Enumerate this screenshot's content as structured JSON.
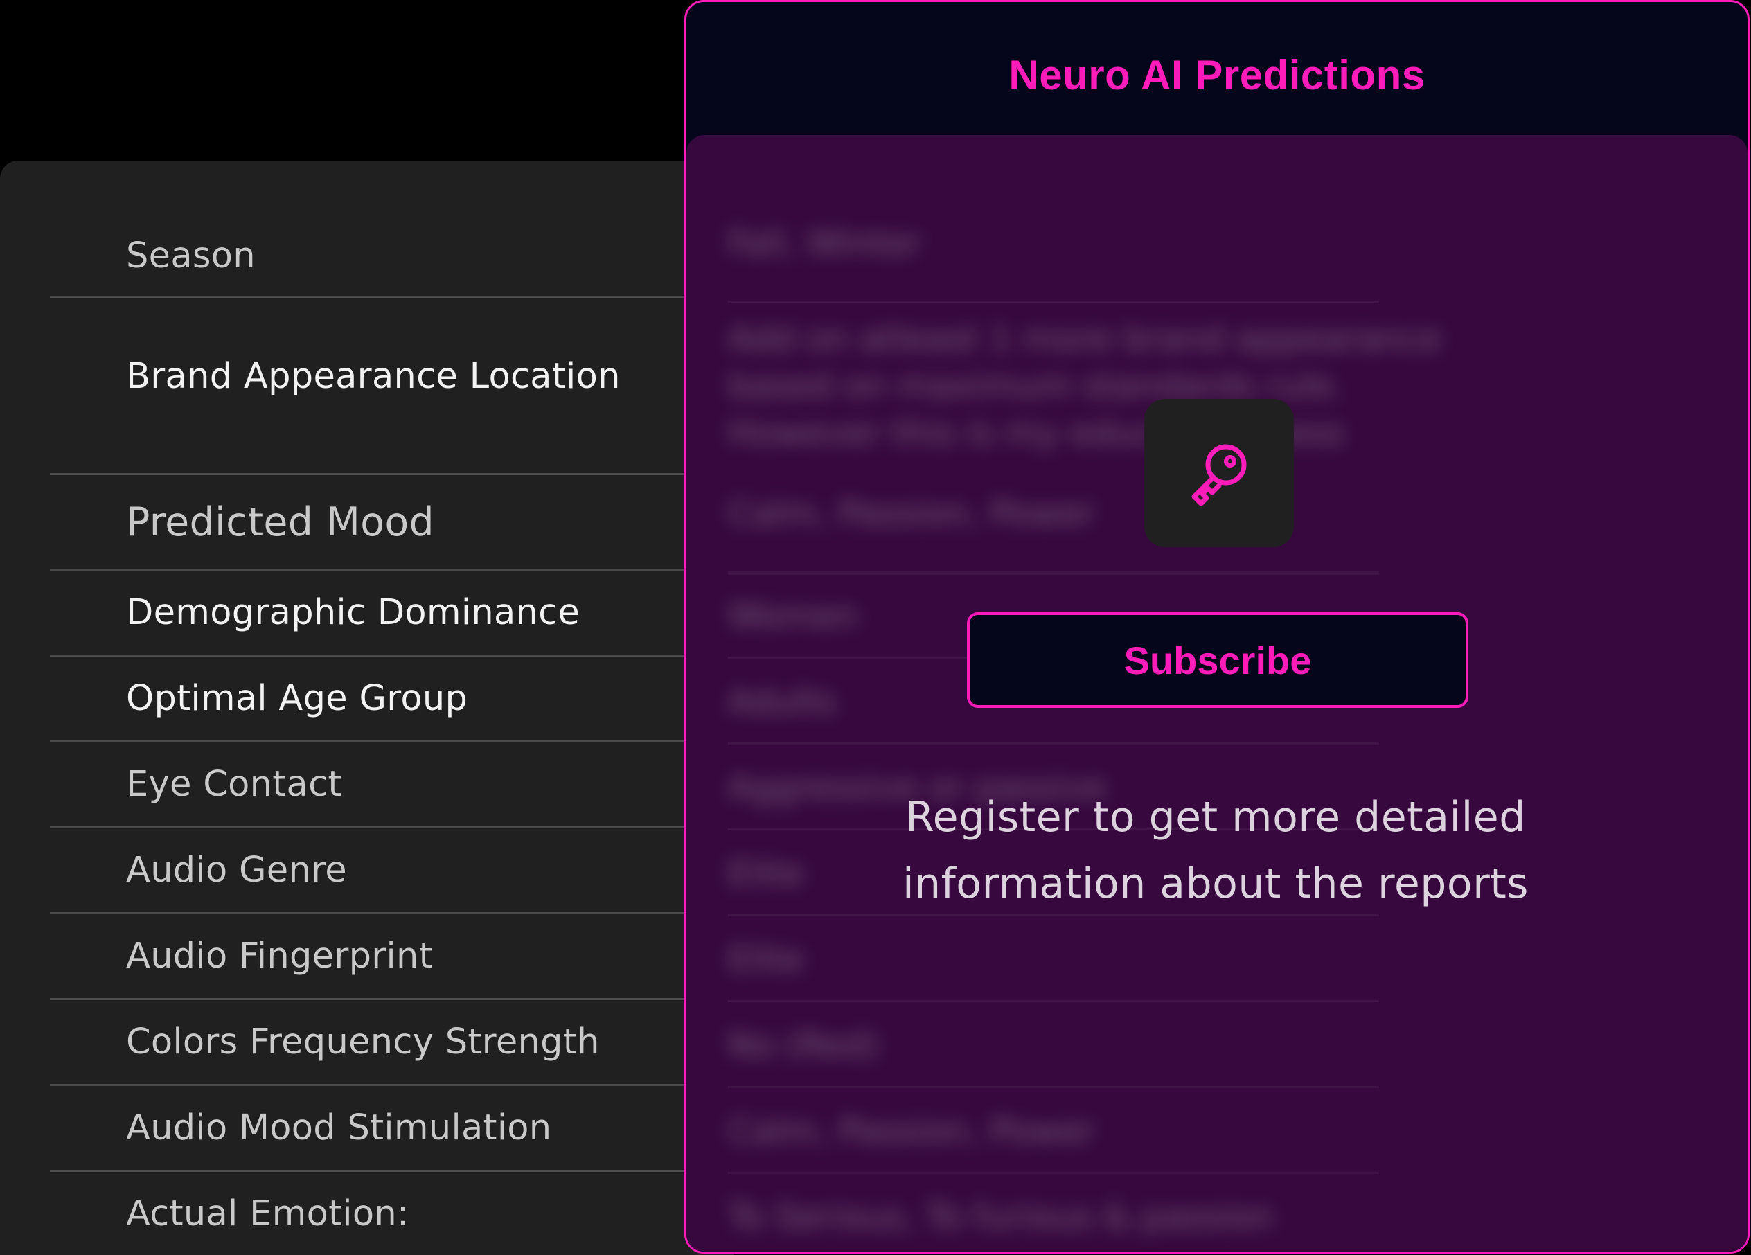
{
  "attributes": [
    {
      "label": "Season"
    },
    {
      "label": "Brand Appearance Location"
    },
    {
      "label": "Predicted Mood"
    },
    {
      "label": "Demographic Dominance"
    },
    {
      "label": "Optimal Age Group"
    },
    {
      "label": "Eye Contact"
    },
    {
      "label": "Audio Genre"
    },
    {
      "label": "Audio Fingerprint"
    },
    {
      "label": "Colors Frequency Strength"
    },
    {
      "label": "Audio Mood Stimulation"
    },
    {
      "label": "Actual Emotion:"
    }
  ],
  "predictions": {
    "title": "Neuro AI Predictions",
    "locked_values": [
      "Fall, Winter",
      "Add on atleast 1 more brand appearance",
      "based on maximum standards rule.",
      "However this is my educated guess",
      "Calm, Passion, Power",
      "Women",
      "Adults",
      "Aggressive or passive",
      "Elite",
      "Elite",
      "No (Red)",
      "Calm, Passion, Power",
      "To Serious, To furious & passion"
    ]
  },
  "overlay": {
    "icon": "key-icon",
    "subscribe_label": "Subscribe",
    "message_line1": "Register to get more detailed",
    "message_line2": "information about the reports"
  },
  "colors": {
    "accent": "#ff1cb8",
    "left_panel": "#202020",
    "card_header": "#05051c",
    "card_body": "#36083e",
    "page_background": "#000000"
  }
}
